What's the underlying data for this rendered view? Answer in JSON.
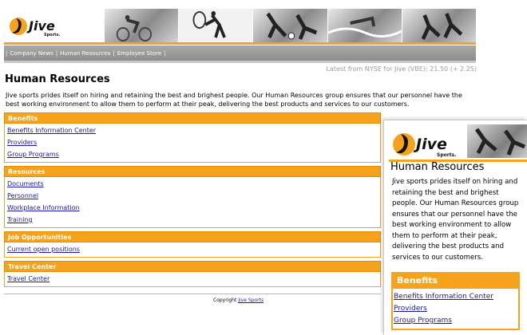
{
  "brand": {
    "logo_text": "Jive",
    "logo_sub": "Sports."
  },
  "nav": {
    "sep": "|",
    "items": [
      "Company News",
      "Human Resources",
      "Employee Store"
    ]
  },
  "ticker": "Latest from NYSE for Jive (VBE): 21.50 (+ 2.25)",
  "page": {
    "title": "Human Resources",
    "intro": "Jive sports prides itself on hiring and retaining the best and brighest people. Our Human Resources group ensures that our personnel have the best working environment to allow them to perform at their peak, delivering the best products and services to our customers."
  },
  "sections": [
    {
      "title": "Benefits",
      "links": [
        "Benefits Information Center",
        "Providers",
        "Group Programs"
      ]
    },
    {
      "title": "Resources",
      "links": [
        "Documents",
        "Personnel",
        "Workplace Information",
        "Training"
      ]
    },
    {
      "title": "Job Opportunities",
      "links": [
        "Current open positions"
      ]
    },
    {
      "title": "Travel Center",
      "links": [
        "Travel Center"
      ]
    }
  ],
  "footer": {
    "copyright": "Copyright",
    "link": "Jive Sports"
  },
  "colors": {
    "accent": "#f6a21a",
    "link": "#1a1aa6",
    "nav_bg": "#9a9a9a"
  },
  "icons": {
    "logo": "jive-logo-icon",
    "photos": "sports-photo-strip"
  }
}
